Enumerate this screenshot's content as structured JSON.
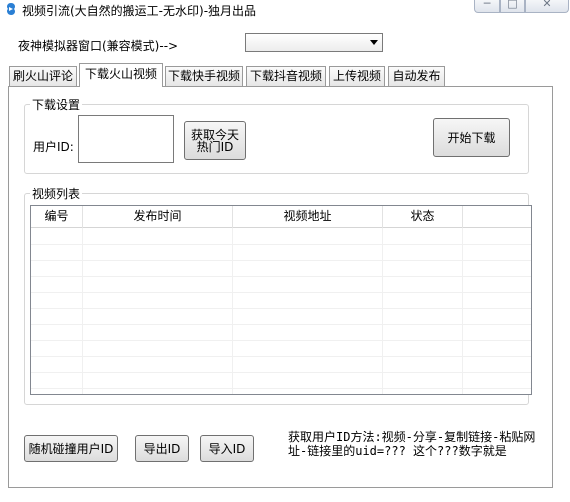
{
  "window": {
    "title": "视频引流(大自然的搬运工-无水印)-独月出品",
    "minimize_glyph": "─",
    "maximize_glyph": "□",
    "close_glyph": "✕"
  },
  "emulator": {
    "label": "夜神模拟器窗口(兼容模式)-->",
    "selected": ""
  },
  "tabs": [
    {
      "label": "刷火山评论",
      "active": false
    },
    {
      "label": "下载火山视频",
      "active": true
    },
    {
      "label": "下载快手视频",
      "active": false
    },
    {
      "label": "下载抖音视频",
      "active": false
    },
    {
      "label": "上传视频",
      "active": false
    },
    {
      "label": "自动发布",
      "active": false
    }
  ],
  "download_settings": {
    "title": "下载设置",
    "user_id_label": "用户ID:",
    "user_id_value": "",
    "get_hot_id_button": "获取今天热门ID",
    "start_download_button": "开始下载"
  },
  "video_list": {
    "title": "视频列表",
    "columns": [
      "编号",
      "发布时间",
      "视频地址",
      "状态"
    ],
    "rows": []
  },
  "bottom": {
    "random_user_button": "随机碰撞用户ID",
    "export_button": "导出ID",
    "import_button": "导入ID",
    "hint": "获取用户ID方法:视频-分享-复制链接-粘贴网址-链接里的uid=??? 这个???数字就是"
  },
  "colors": {
    "app_icon": "#2a7fd4",
    "border": "#9a9a9a",
    "group_border": "#d6d6d6"
  }
}
